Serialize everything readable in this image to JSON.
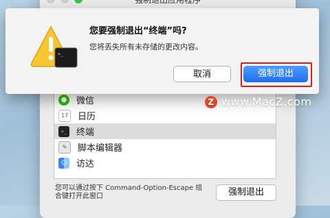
{
  "background_window": {
    "title": "强制退出应用程序",
    "apps": [
      {
        "name": "微信",
        "icon": "wechat-icon"
      },
      {
        "name": "日历",
        "icon": "calendar-icon"
      },
      {
        "name": "终端",
        "icon": "terminal-icon",
        "selected": true
      },
      {
        "name": "脚本编辑器",
        "icon": "script-editor-icon"
      },
      {
        "name": "访达",
        "icon": "finder-icon"
      }
    ],
    "footer_text": "您可以通过按下 Command-Option-Escape 组合键打开此窗口",
    "force_quit_button": "强制退出"
  },
  "alert": {
    "title": "您要强制退出“终端”吗?",
    "message": "您将丢失所有未存储的更改内容。",
    "cancel_button": "取消",
    "confirm_button": "强制退出",
    "icon": "warning-terminal-icon",
    "accent_color": "#1f6ef0",
    "highlight_color": "#e01b1b"
  },
  "watermark": {
    "text": "www.MacZ.com",
    "badge": "Z"
  }
}
